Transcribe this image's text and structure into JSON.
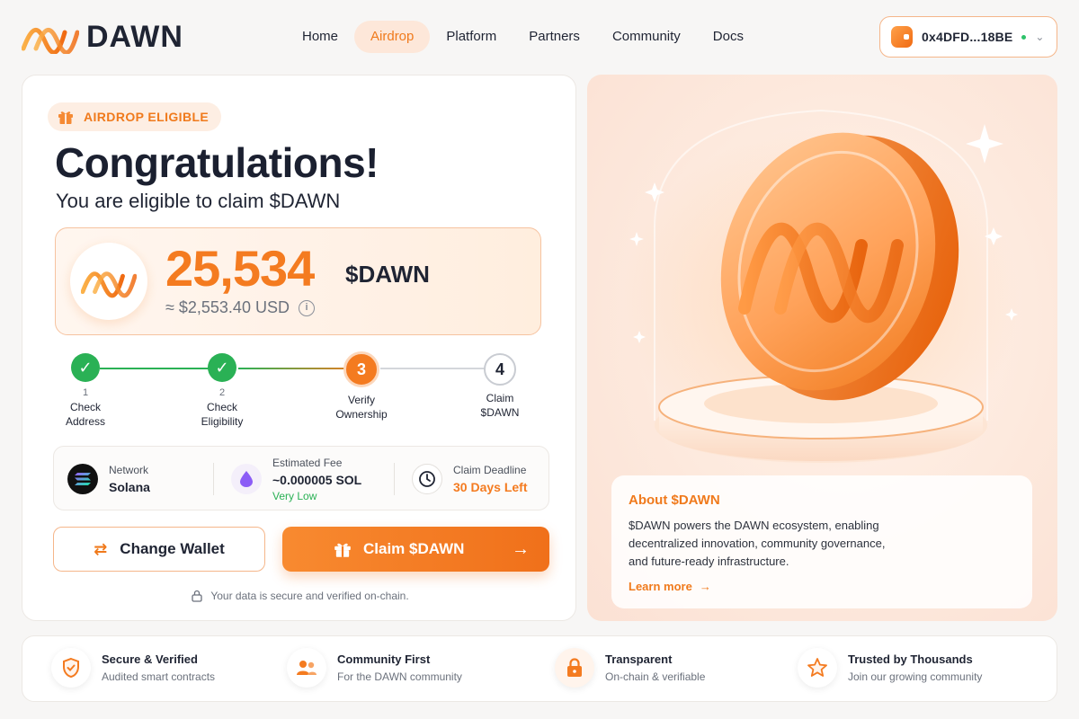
{
  "brand": {
    "name": "DAWN"
  },
  "nav": {
    "items": [
      {
        "label": "Home",
        "active": false
      },
      {
        "label": "Airdrop",
        "active": true
      },
      {
        "label": "Platform",
        "active": false
      },
      {
        "label": "Partners",
        "active": false
      },
      {
        "label": "Community",
        "active": false
      },
      {
        "label": "Docs",
        "active": false
      }
    ]
  },
  "wallet": {
    "address": "0x4DFD...18BE",
    "icon": "wallet-icon",
    "status_color": "#2ec26a"
  },
  "eligibility": {
    "badge": "AIRDROP ELIGIBLE",
    "title": "Congratulations!",
    "subtitle": "You are eligible to claim $DAWN"
  },
  "claim": {
    "amount": "25,534",
    "token": "$DAWN",
    "usd_value": "≈ $2,553.40 USD"
  },
  "steps": [
    {
      "number": "1",
      "label_line1": "Check",
      "label_line2": "Address",
      "state": "done"
    },
    {
      "number": "2",
      "label_line1": "Check",
      "label_line2": "Eligibility",
      "state": "done"
    },
    {
      "number": "3",
      "label_line1": "Verify",
      "label_line2": "Ownership",
      "state": "current"
    },
    {
      "number": "4",
      "label_line1": "Claim",
      "label_line2": "$DAWN",
      "state": "todo"
    }
  ],
  "details": {
    "network_label": "Network",
    "network_value": "Solana",
    "fee_label": "Estimated Fee",
    "fee_value": "~0.000005 SOL",
    "fee_note": "Very Low",
    "deadline_label": "Claim Deadline",
    "deadline_value": "30 Days Left"
  },
  "actions": {
    "change_wallet": "Change Wallet",
    "claim": "Claim $DAWN"
  },
  "secure_note": "Your data is secure and verified on-chain.",
  "about": {
    "title": "About $DAWN",
    "text": "$DAWN powers the DAWN ecosystem, enabling decentralized innovation, community governance, and future-ready infrastructure.",
    "link": "Learn more"
  },
  "features": [
    {
      "title": "Secure & Verified",
      "subtitle": "Audited smart contracts",
      "icon": "shield-icon"
    },
    {
      "title": "Community First",
      "subtitle": "For the DAWN community",
      "icon": "users-icon"
    },
    {
      "title": "Transparent",
      "subtitle": "On-chain & verifiable",
      "icon": "lock-icon"
    },
    {
      "title": "Trusted by Thousands",
      "subtitle": "Join our growing community",
      "icon": "star-icon"
    }
  ],
  "colors": {
    "accent": "#f47b20",
    "success": "#2ab155",
    "text": "#1f2433"
  }
}
